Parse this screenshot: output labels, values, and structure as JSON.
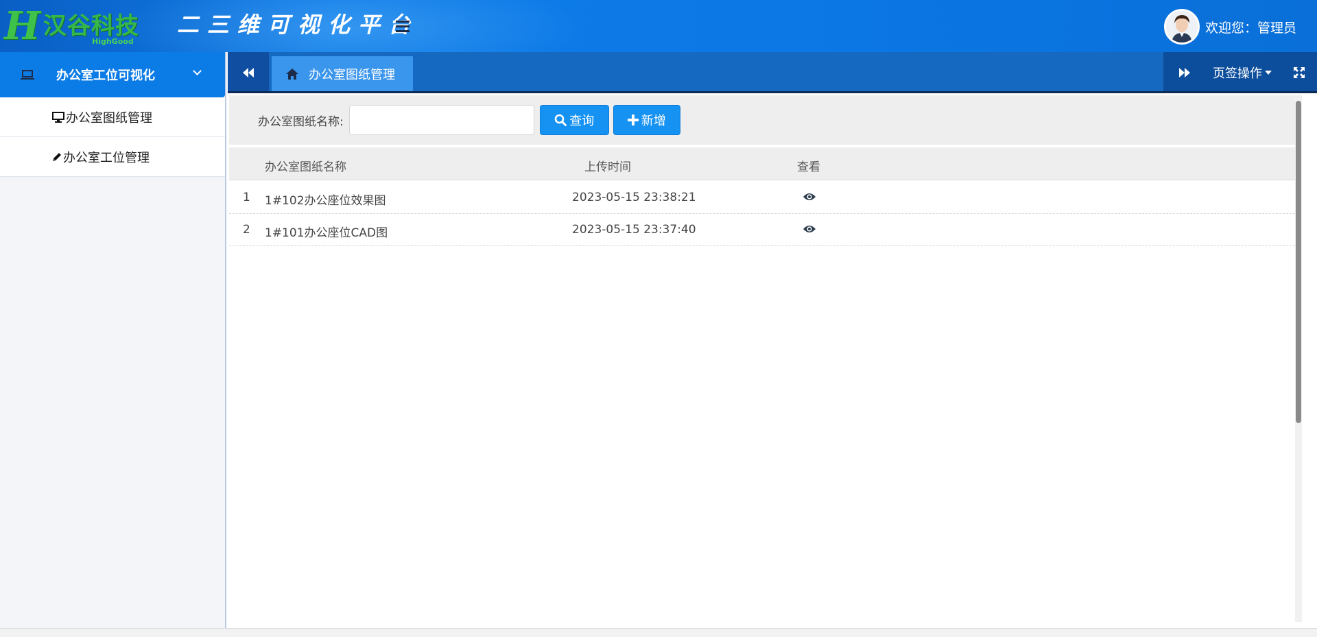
{
  "header": {
    "logo_mark": "H",
    "logo_cn": "汉谷科技",
    "logo_en": "HighGood",
    "platform_title": "二三维可视化平台",
    "welcome": "欢迎您：管理员"
  },
  "sidebar": {
    "group_label": "办公室工位可视化",
    "items": [
      {
        "label": "办公室图纸管理",
        "icon": "monitor-icon"
      },
      {
        "label": "办公室工位管理",
        "icon": "pencil-icon"
      }
    ]
  },
  "tabs": {
    "active_tab": "办公室图纸管理",
    "page_ops_label": "页签操作"
  },
  "search": {
    "label": "办公室图纸名称:",
    "value": "",
    "placeholder": "",
    "query_button": "查询",
    "add_button": "新增"
  },
  "table": {
    "columns": [
      "办公室图纸名称",
      "上传时间",
      "查看"
    ],
    "rows": [
      {
        "index": "1",
        "name": "1#102办公座位效果图",
        "time": "2023-05-15 23:38:21"
      },
      {
        "index": "2",
        "name": "1#101办公座位CAD图",
        "time": "2023-05-15 23:37:40"
      }
    ]
  },
  "colors": {
    "header_blue": "#0b78e6",
    "tab_bar": "#1569c0",
    "active_tab": "#3a95ec",
    "button_blue": "#1692f2",
    "logo_green": "#35b84a"
  }
}
